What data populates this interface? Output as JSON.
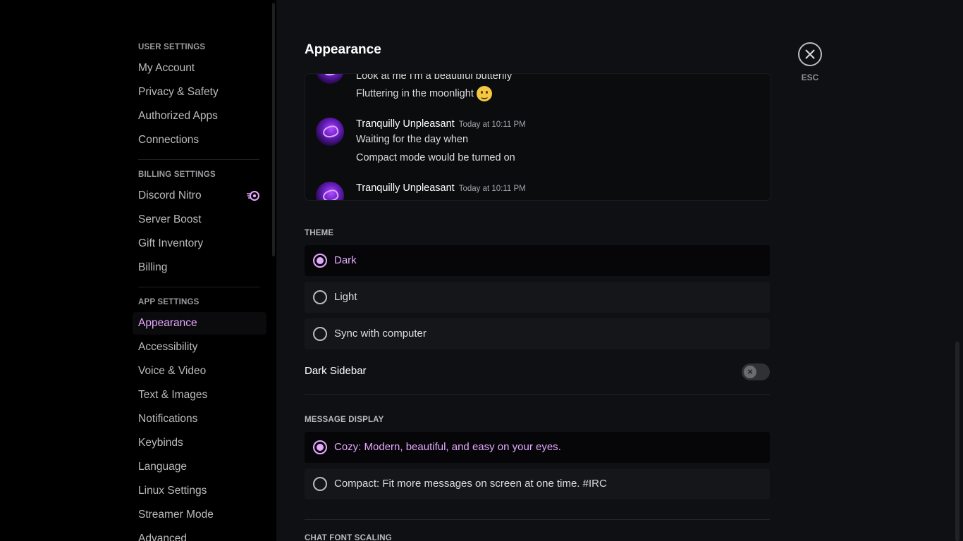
{
  "sidebar": {
    "sections": [
      {
        "header": "User Settings",
        "items": [
          "My Account",
          "Privacy & Safety",
          "Authorized Apps",
          "Connections"
        ]
      },
      {
        "header": "Billing Settings",
        "items": [
          "Discord Nitro",
          "Server Boost",
          "Gift Inventory",
          "Billing"
        ]
      },
      {
        "header": "App Settings",
        "items": [
          "Appearance",
          "Accessibility",
          "Voice & Video",
          "Text & Images",
          "Notifications",
          "Keybinds",
          "Language",
          "Linux Settings",
          "Streamer Mode",
          "Advanced"
        ]
      }
    ],
    "active_item": "Appearance"
  },
  "main": {
    "title": "Appearance",
    "preview": {
      "messages": [
        {
          "line1": "Look at me I'm a beautiful butterfly",
          "line2": "Fluttering in the moonlight"
        },
        {
          "author": "Tranquilly Unpleasant",
          "timestamp": "Today at 10:11 PM",
          "line1": "Waiting for the day when",
          "line2": "Compact mode would be turned on"
        },
        {
          "author": "Tranquilly Unpleasant",
          "timestamp": "Today at 10:11 PM"
        }
      ]
    },
    "theme": {
      "label": "Theme",
      "options": [
        "Dark",
        "Light",
        "Sync with computer"
      ],
      "selected": "Dark"
    },
    "dark_sidebar": {
      "label": "Dark Sidebar",
      "enabled": false
    },
    "message_display": {
      "label": "Message Display",
      "options": [
        "Cozy: Modern, beautiful, and easy on your eyes.",
        "Compact: Fit more messages on screen at one time. #IRC"
      ],
      "selected": "Cozy: Modern, beautiful, and easy on your eyes."
    },
    "chat_font_scaling": {
      "label": "Chat Font Scaling"
    }
  },
  "close": {
    "label": "ESC"
  },
  "colors": {
    "accent": "#e6a8ff",
    "background": "#0f1014",
    "sidebar": "#000000"
  }
}
